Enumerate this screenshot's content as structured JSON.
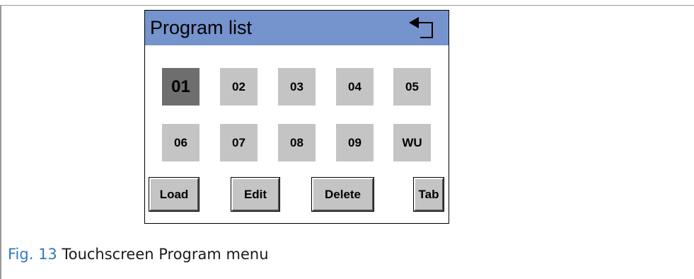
{
  "screen": {
    "title": "Program list",
    "back_icon": "return-arrow-icon",
    "title_bar_color": "#7593cc",
    "programs": [
      {
        "label": "01",
        "selected": true
      },
      {
        "label": "02",
        "selected": false
      },
      {
        "label": "03",
        "selected": false
      },
      {
        "label": "04",
        "selected": false
      },
      {
        "label": "05",
        "selected": false
      },
      {
        "label": "06",
        "selected": false
      },
      {
        "label": "07",
        "selected": false
      },
      {
        "label": "08",
        "selected": false
      },
      {
        "label": "09",
        "selected": false
      },
      {
        "label": "WU",
        "selected": false
      }
    ],
    "buttons": {
      "load": "Load",
      "edit": "Edit",
      "delete": "Delete",
      "tab": "Tab"
    }
  },
  "caption": {
    "label": "Fig. 13",
    "text": " Touchscreen Program menu",
    "label_color": "#2f79c0"
  }
}
